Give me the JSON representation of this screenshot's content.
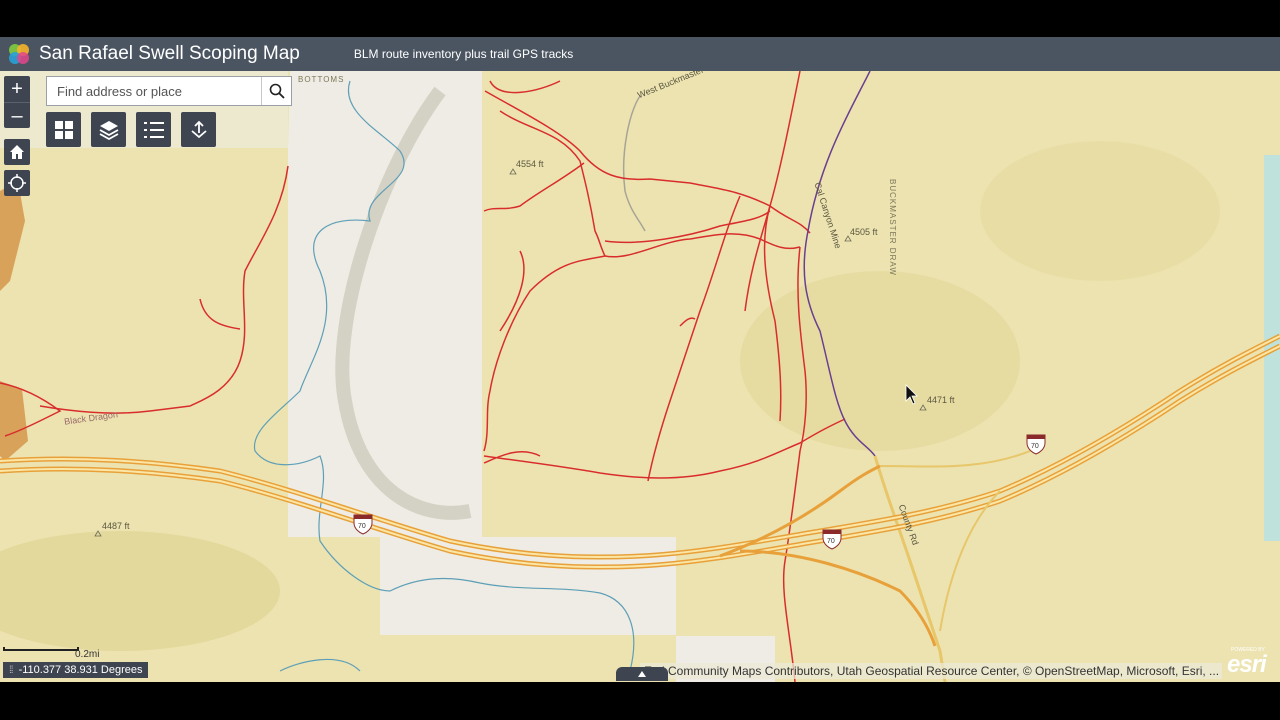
{
  "header": {
    "title": "San Rafael Swell Scoping Map",
    "subtitle": "BLM route inventory plus trail GPS tracks"
  },
  "search": {
    "placeholder": "Find address or place",
    "icon": "search-icon"
  },
  "zoom": {
    "in_label": "+",
    "out_label": "–"
  },
  "toolbar": {
    "icons": [
      "basemap-gallery-icon",
      "layers-icon",
      "legend-icon",
      "share-icon"
    ]
  },
  "map": {
    "labels": {
      "bottoms": "BOTTOMS",
      "west_buckmaster": "West Buckmaster",
      "elev_4554": "4554 ft",
      "elev_4505": "4505 ft",
      "elev_4471": "4471 ft",
      "elev_4487": "4487 ft",
      "buckmaster_draw": "BUCKMASTER DRAW",
      "black_dragon": "Black Dragon",
      "county_rd": "County Rd",
      "canyon_mine": "Cal Canyon Mine",
      "interstate": "70"
    },
    "colors": {
      "land": "#ece3b0",
      "land_dark": "#e2d59a",
      "gray_area": "#eeece4",
      "route": "#d92d2d",
      "highway": "#e8a13a",
      "stream": "#5e9fb7",
      "track": "#6b3f8f"
    }
  },
  "scalebar": {
    "label": "0.2mi"
  },
  "coordinates": {
    "text": "-110.377 38.931 Degrees"
  },
  "attribution": {
    "text": "Esri Community Maps Contributors, Utah Geospatial Resource Center, © OpenStreetMap, Microsoft, Esri, ..."
  },
  "esri": {
    "powered": "POWERED BY",
    "logo_text": "esri"
  }
}
